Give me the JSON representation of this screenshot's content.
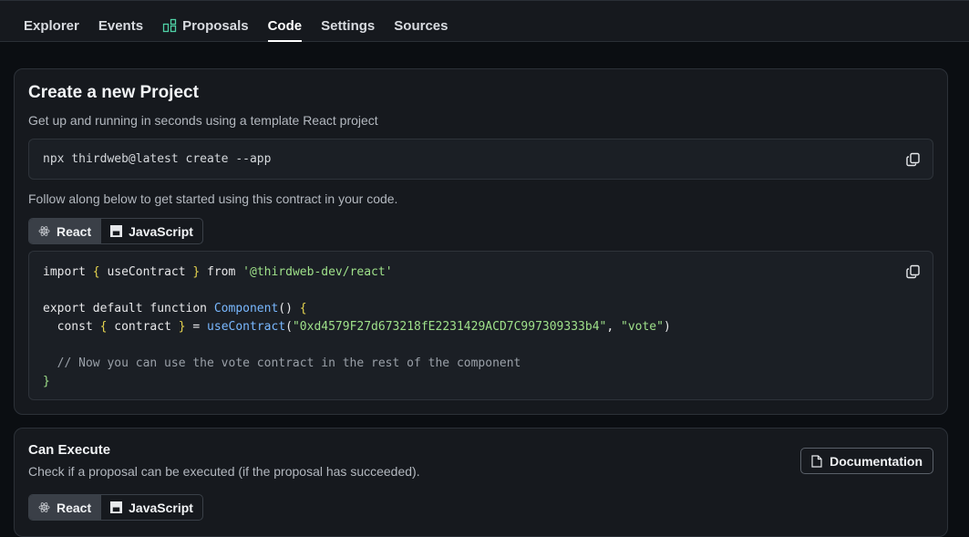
{
  "nav": {
    "tabs": [
      {
        "label": "Explorer"
      },
      {
        "label": "Events"
      },
      {
        "label": "Proposals",
        "icon": "proposals-icon"
      },
      {
        "label": "Code",
        "active": true
      },
      {
        "label": "Settings"
      },
      {
        "label": "Sources"
      }
    ]
  },
  "create_project": {
    "title": "Create a new Project",
    "description": "Get up and running in seconds using a template React project",
    "command": "npx thirdweb@latest create --app",
    "follow_text": "Follow along below to get started using this contract in your code.",
    "lang_tabs": {
      "react": "React",
      "javascript": "JavaScript"
    },
    "code": {
      "line1_kw1": "import",
      "line1_brace1": "{",
      "line1_name": " useContract ",
      "line1_brace2": "}",
      "line1_kw2": " from ",
      "line1_str": "'@thirdweb-dev/react'",
      "line3_kw": "export default function ",
      "line3_fn": "Component",
      "line3_paren": "() ",
      "line3_brace": "{",
      "line4_kw": "  const ",
      "line4_brace1": "{",
      "line4_name": " contract ",
      "line4_brace2": "}",
      "line4_eq": " = ",
      "line4_fn": "useContract",
      "line4_p1": "(",
      "line4_str1": "\"0xd4579F27d673218fE2231429ACD7C997309333b4\"",
      "line4_comma": ", ",
      "line4_str2": "\"vote\"",
      "line4_p2": ")",
      "line6_comment": "  // Now you can use the vote contract in the rest of the component",
      "line7_brace": "}"
    }
  },
  "can_execute": {
    "title": "Can Execute",
    "description": "Check if a proposal can be executed (if the proposal has succeeded).",
    "doc_button": "Documentation",
    "lang_tabs": {
      "react": "React",
      "javascript": "JavaScript"
    }
  }
}
